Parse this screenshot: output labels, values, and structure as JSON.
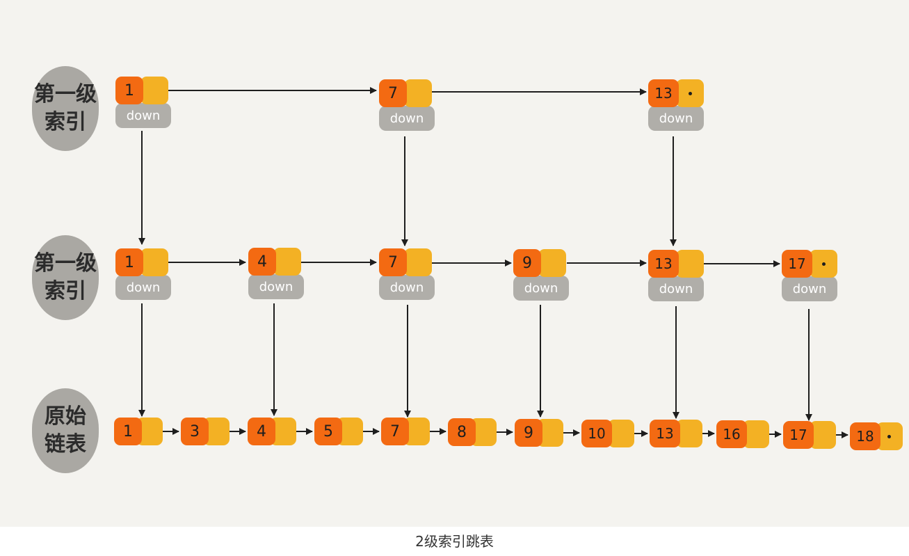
{
  "levels": {
    "level2_label": [
      "第一级",
      "索引"
    ],
    "level1_label": [
      "第一级",
      "索引"
    ],
    "base_label": [
      "原始",
      "链表"
    ]
  },
  "down_label": "down",
  "nodes": {
    "level2": [
      "1",
      "7",
      "13"
    ],
    "level1": [
      "1",
      "4",
      "7",
      "9",
      "13",
      "17"
    ],
    "base": [
      "1",
      "3",
      "4",
      "5",
      "7",
      "8",
      "9",
      "10",
      "13",
      "16",
      "17",
      "18"
    ]
  },
  "caption": "2级索引跳表",
  "colors": {
    "value_cell": "#f36a12",
    "next_cell": "#f3b124",
    "down_cell": "#b0aea9",
    "label_bubble": "#aaa8a3",
    "background": "#f4f3ef"
  }
}
